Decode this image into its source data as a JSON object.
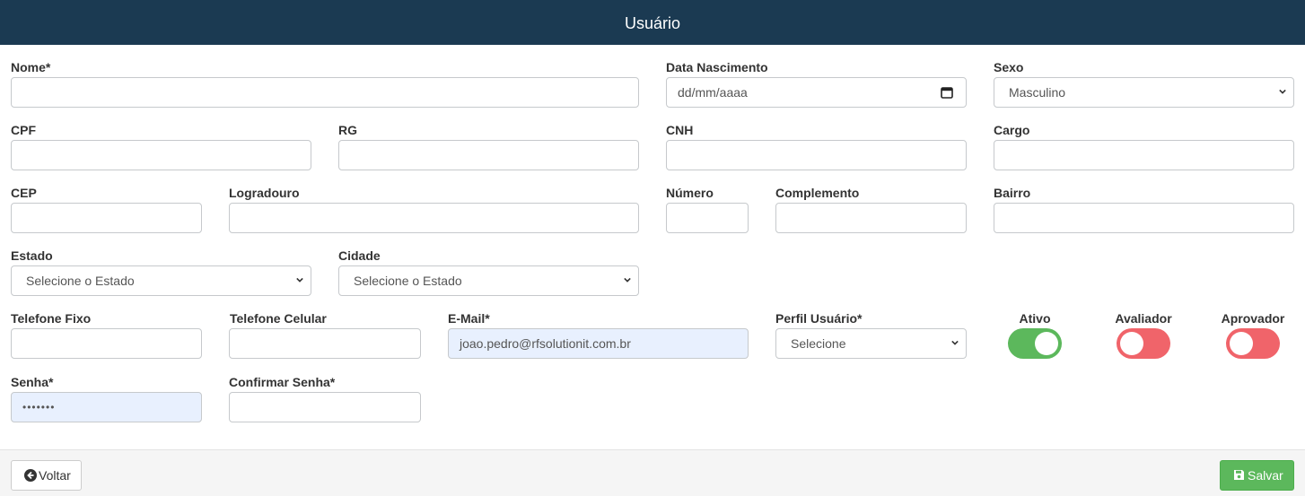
{
  "header": {
    "title": "Usuário"
  },
  "form": {
    "nome": {
      "label": "Nome*",
      "value": ""
    },
    "data_nascimento": {
      "label": "Data Nascimento",
      "placeholder": "dd/mm/aaaa"
    },
    "sexo": {
      "label": "Sexo",
      "selected": "Masculino"
    },
    "cpf": {
      "label": "CPF",
      "value": ""
    },
    "rg": {
      "label": "RG",
      "value": ""
    },
    "cnh": {
      "label": "CNH",
      "value": ""
    },
    "cargo": {
      "label": "Cargo",
      "value": ""
    },
    "cep": {
      "label": "CEP",
      "value": ""
    },
    "logradouro": {
      "label": "Logradouro",
      "value": ""
    },
    "numero": {
      "label": "Número",
      "value": ""
    },
    "complemento": {
      "label": "Complemento",
      "value": ""
    },
    "bairro": {
      "label": "Bairro",
      "value": ""
    },
    "estado": {
      "label": "Estado",
      "selected": "Selecione o Estado"
    },
    "cidade": {
      "label": "Cidade",
      "selected": "Selecione o Estado"
    },
    "telefone_fixo": {
      "label": "Telefone Fixo",
      "value": ""
    },
    "telefone_celular": {
      "label": "Telefone Celular",
      "value": ""
    },
    "email": {
      "label": "E-Mail*",
      "value": "joao.pedro@rfsolutionit.com.br"
    },
    "perfil_usuario": {
      "label": "Perfil Usuário*",
      "selected": "Selecione"
    },
    "senha": {
      "label": "Senha*",
      "value": "•••••••"
    },
    "confirmar_senha": {
      "label": "Confirmar Senha*",
      "value": ""
    }
  },
  "toggles": {
    "ativo": {
      "label": "Ativo",
      "on": true,
      "color": "#5cb85c"
    },
    "avaliador": {
      "label": "Avaliador",
      "on": false,
      "color": "#f0646a"
    },
    "aprovador": {
      "label": "Aprovador",
      "on": false,
      "color": "#f0646a"
    }
  },
  "footer": {
    "back_label": "Voltar",
    "save_label": "Salvar",
    "back_icon": "arrow-circle-left-icon",
    "save_icon": "floppy-disk-icon"
  },
  "colors": {
    "header_bg": "#1b3a52",
    "save_green": "#5cb85c",
    "toggle_off": "#f0646a",
    "autofill_bg": "#e8f0fe"
  }
}
